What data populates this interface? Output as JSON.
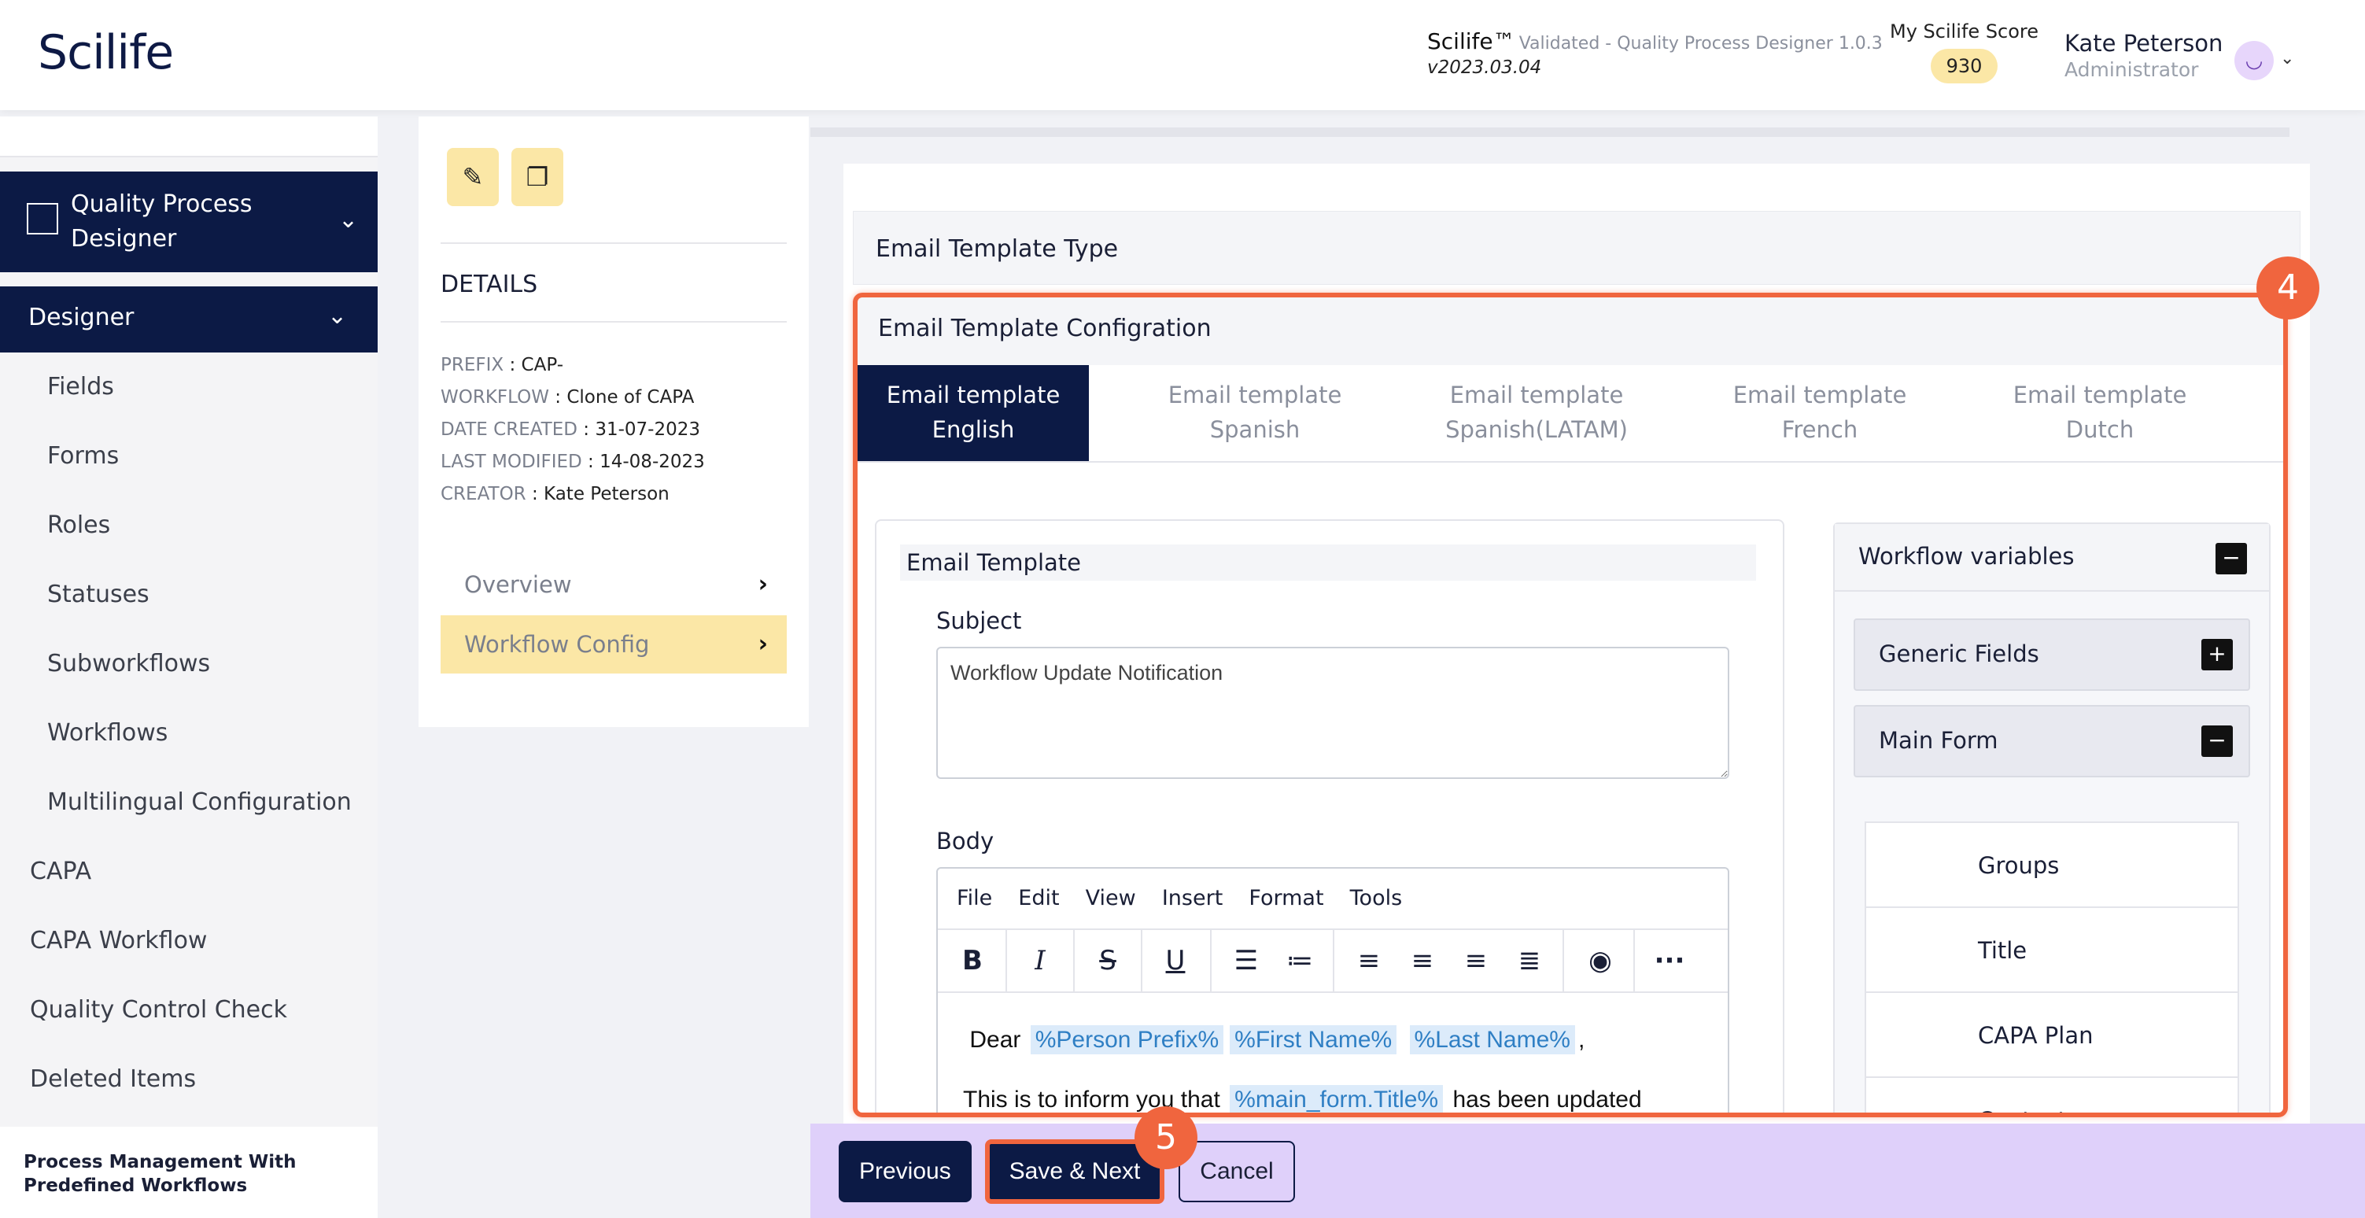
{
  "header": {
    "logo": "Scilife",
    "app_name": "Scilife™",
    "app_sub": "Validated - Quality Process Designer 1.0.3",
    "version": "v2023.03.04",
    "score_label": "My Scilife Score",
    "score_value": "930",
    "user_name": "Kate Peterson",
    "user_role": "Administrator"
  },
  "sidebar": {
    "section": "Quality Process Designer",
    "group": "Designer",
    "sub_items": [
      "Fields",
      "Forms",
      "Roles",
      "Statuses",
      "Subworkflows",
      "Workflows",
      "Multilingual Configuration"
    ],
    "top_items": [
      "CAPA",
      "CAPA Workflow",
      "Quality Control Check",
      "Deleted Items"
    ],
    "footer": "Process Management With Predefined Workflows"
  },
  "details": {
    "title": "DETAILS",
    "meta": [
      {
        "key": "PREFIX",
        "value": "CAP-"
      },
      {
        "key": "WORKFLOW",
        "value": "Clone of CAPA"
      },
      {
        "key": "DATE CREATED",
        "value": "31-07-2023"
      },
      {
        "key": "LAST MODIFIED",
        "value": "14-08-2023"
      },
      {
        "key": "CREATOR",
        "value": "Kate Peterson"
      }
    ],
    "nav": [
      "Overview",
      "Workflow Config"
    ]
  },
  "main": {
    "type_label": "Email Template Type",
    "config_label": "Email Template Configration",
    "tabs": [
      {
        "line1": "Email template",
        "line2": "English"
      },
      {
        "line1": "Email template",
        "line2": "Spanish"
      },
      {
        "line1": "Email template",
        "line2": "Spanish(LATAM)"
      },
      {
        "line1": "Email template",
        "line2": "French"
      },
      {
        "line1": "Email template",
        "line2": "Dutch"
      }
    ],
    "template_title": "Email Template",
    "subject_label": "Subject",
    "subject_value": "Workflow Update Notification",
    "body_label": "Body",
    "menu": [
      "File",
      "Edit",
      "View",
      "Insert",
      "Format",
      "Tools"
    ],
    "body": {
      "dear": "Dear",
      "var1": "%Person Prefix%",
      "var2": "%First Name%",
      "var3": "%Last Name%",
      "comma": ",",
      "line2_a": "This is to inform you that",
      "var4": "%main_form.Title%",
      "line2_b": "has been updated"
    },
    "workflow_vars": {
      "title": "Workflow variables",
      "generic": "Generic Fields",
      "main_form": "Main Form",
      "items": [
        "Groups",
        "Title",
        "CAPA Plan",
        "Contacts"
      ]
    }
  },
  "steps": {
    "four": "4",
    "five": "5"
  },
  "footer": {
    "previous": "Previous",
    "save_next": "Save & Next",
    "cancel": "Cancel"
  },
  "colors": {
    "navy": "#0c1a45",
    "accent": "#f0653e",
    "yellow": "#fbe7a6",
    "lilac": "#dfd0fa"
  }
}
